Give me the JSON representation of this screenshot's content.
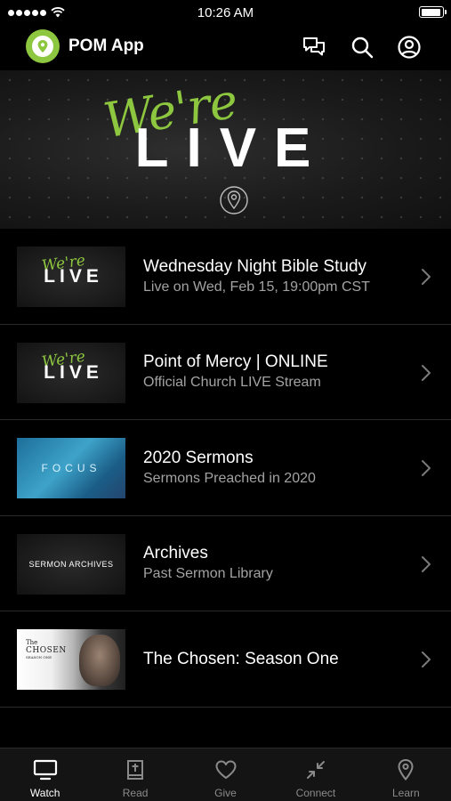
{
  "status_bar": {
    "time": "10:26 AM",
    "battery_level": 0.93
  },
  "header": {
    "title": "POM App",
    "icons": [
      "chat-icon",
      "search-icon",
      "account-icon"
    ]
  },
  "hero": {
    "cursive_text": "We're",
    "main_text": "LIVE"
  },
  "media_items": [
    {
      "title": "Wednesday Night Bible Study",
      "subtitle": "Live on Wed, Feb 15, 19:00pm CST",
      "thumbnail": {
        "cursive": "We're",
        "text": "LIVE"
      }
    },
    {
      "title": "Point of Mercy | ONLINE",
      "subtitle": "Official Church LIVE Stream",
      "thumbnail": {
        "cursive": "We're",
        "text": "LIVE"
      }
    },
    {
      "title": "2020 Sermons",
      "subtitle": "Sermons Preached in 2020",
      "thumbnail": {
        "text": "FOCUS"
      }
    },
    {
      "title": "Archives",
      "subtitle": "Past Sermon Library",
      "thumbnail": {
        "text": "SERMON ARCHIVES"
      }
    },
    {
      "title": "The Chosen: Season One",
      "subtitle": "",
      "thumbnail": {
        "the": "The",
        "text": "CHOSEN",
        "sub": "SEASON ONE"
      }
    }
  ],
  "tabs": [
    {
      "label": "Watch",
      "icon": "tv-icon",
      "active": true
    },
    {
      "label": "Read",
      "icon": "book-icon",
      "active": false
    },
    {
      "label": "Give",
      "icon": "heart-icon",
      "active": false
    },
    {
      "label": "Connect",
      "icon": "connect-icon",
      "active": false
    },
    {
      "label": "Learn",
      "icon": "location-pin-icon",
      "active": false
    }
  ],
  "colors": {
    "accent": "#8dc63f",
    "background": "#000000",
    "subtitle": "#a3a3a3",
    "tab_inactive": "#8a8a8a"
  }
}
